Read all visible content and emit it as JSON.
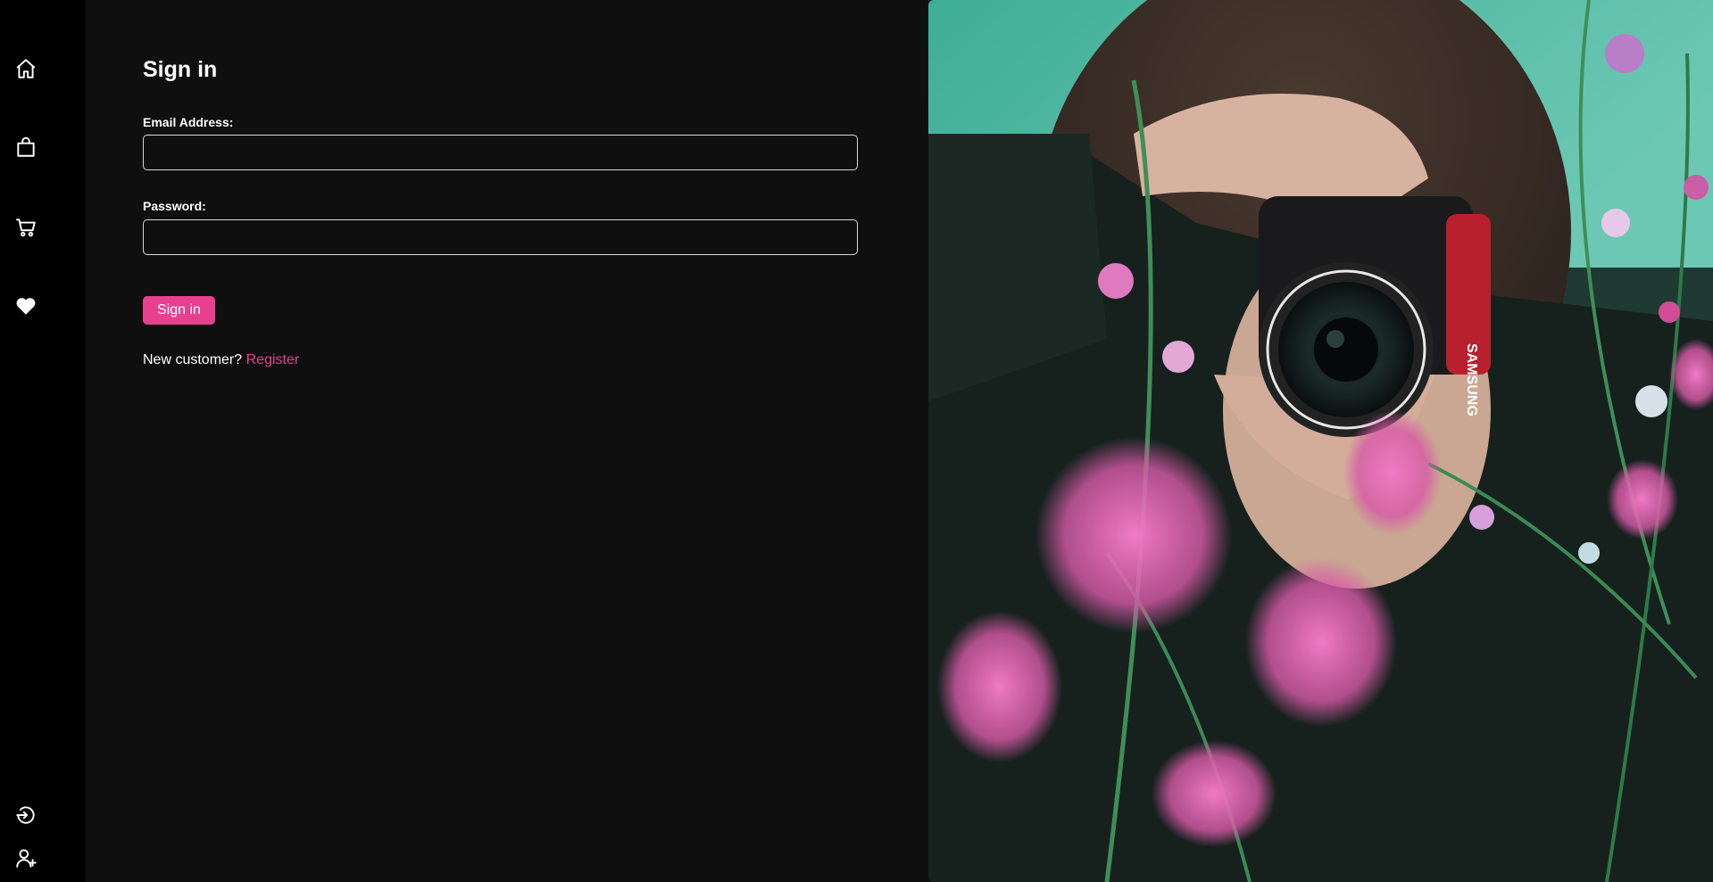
{
  "sidebar": {
    "top_icons": [
      "home-icon",
      "shopping-bag-icon",
      "cart-icon",
      "heart-icon"
    ],
    "bottom_icons": [
      "login-icon",
      "add-user-icon"
    ]
  },
  "form": {
    "title": "Sign in",
    "email_label": "Email Address:",
    "email_value": "",
    "password_label": "Password:",
    "password_value": "",
    "submit_label": "Sign in",
    "new_customer_text": "New customer?",
    "register_link": "Register"
  },
  "colors": {
    "accent": "#e8408f",
    "sidebar_bg": "#000000",
    "main_bg": "#0f0f10"
  },
  "hero_image": {
    "description_icon": "photographer-with-camera-in-flowers-image",
    "camera_brand_text": "SAMSUNG"
  }
}
